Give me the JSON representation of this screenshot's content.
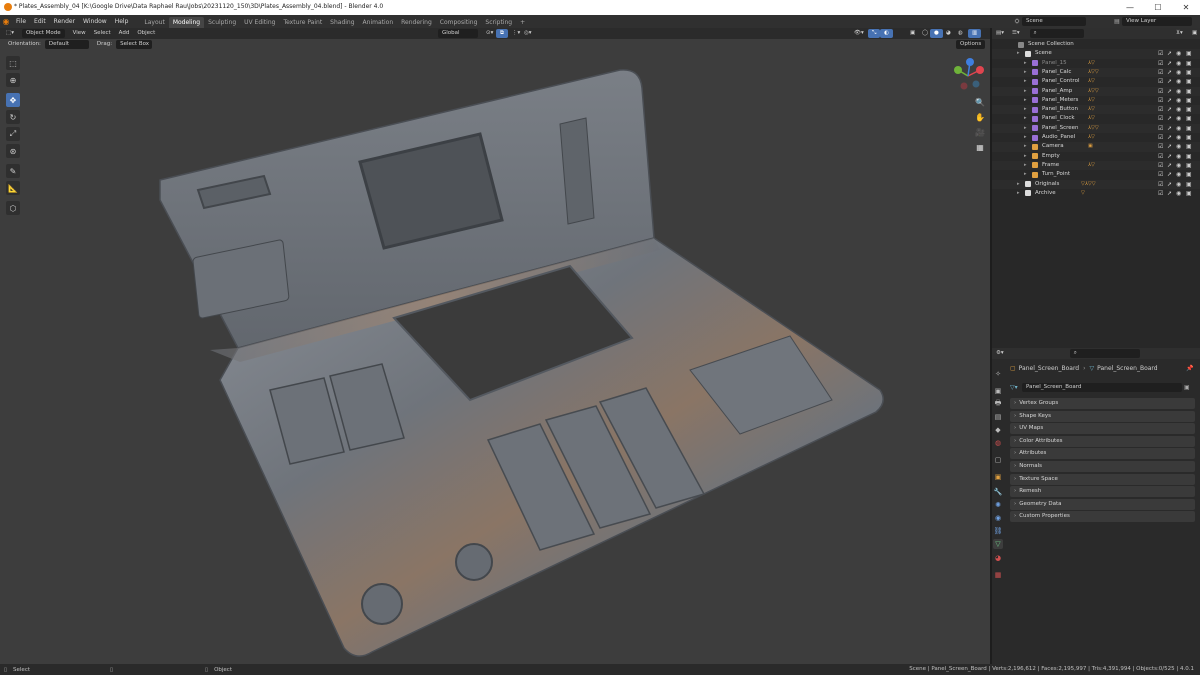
{
  "window": {
    "title": "* Plates_Assembly_04 [K:\\Google Drive\\Data Raphael Rau\\Jobs\\20231120_150\\3D\\Plates_Assembly_04.blend] - Blender 4.0",
    "minimize": "—",
    "maximize": "☐",
    "close": "✕"
  },
  "menus": [
    "File",
    "Edit",
    "Render",
    "Window",
    "Help"
  ],
  "workspaces": [
    "Layout",
    "Modeling",
    "Sculpting",
    "UV Editing",
    "Texture Paint",
    "Shading",
    "Animation",
    "Rendering",
    "Compositing",
    "Scripting"
  ],
  "active_workspace": "Modeling",
  "add_workspace": "+",
  "top_right": {
    "scene_label": "Scene",
    "view_layer_label": "View Layer"
  },
  "viewport_header": {
    "mode": "Object Mode",
    "menus": [
      "View",
      "Select",
      "Add",
      "Object"
    ],
    "transform_orientation": "Global",
    "orientation_label": "Orientation:",
    "orientation_value": "Default",
    "drag_label": "Drag:",
    "drag_value": "Select Box",
    "options": "Options"
  },
  "outliner": {
    "search_placeholder": "",
    "rows": [
      {
        "name": "Scene Collection",
        "depth": 0,
        "icon": "#888888",
        "mods": ""
      },
      {
        "name": "Scene",
        "depth": 1,
        "icon": "#dddddd",
        "mods": ""
      },
      {
        "name": "Panel_15",
        "depth": 2,
        "icon": "#9a6fd6",
        "mods": "⅄▽",
        "dim": true
      },
      {
        "name": "Panel_Calc",
        "depth": 2,
        "icon": "#9a6fd6",
        "mods": "⅄▽▽"
      },
      {
        "name": "Panel_Control",
        "depth": 2,
        "icon": "#9a6fd6",
        "mods": "⅄▽"
      },
      {
        "name": "Panel_Amp",
        "depth": 2,
        "icon": "#9a6fd6",
        "mods": "⅄▽▽"
      },
      {
        "name": "Panel_Meters",
        "depth": 2,
        "icon": "#9a6fd6",
        "mods": "⅄▽"
      },
      {
        "name": "Panel_Button",
        "depth": 2,
        "icon": "#9a6fd6",
        "mods": "⅄▽"
      },
      {
        "name": "Panel_Clock",
        "depth": 2,
        "icon": "#9a6fd6",
        "mods": "⅄▽"
      },
      {
        "name": "Panel_Screen",
        "depth": 2,
        "icon": "#9a6fd6",
        "mods": "⅄▽▽"
      },
      {
        "name": "Audio_Panel",
        "depth": 2,
        "icon": "#9a6fd6",
        "mods": "⅄▽"
      },
      {
        "name": "Camera",
        "depth": 2,
        "icon": "#e0a040",
        "mods": "▣"
      },
      {
        "name": "Empty",
        "depth": 2,
        "icon": "#e0a040",
        "mods": ""
      },
      {
        "name": "Frame",
        "depth": 2,
        "icon": "#e0a040",
        "mods": "⅄▽"
      },
      {
        "name": "Turn_Point",
        "depth": 2,
        "icon": "#e0a040",
        "mods": ""
      },
      {
        "name": "Originals",
        "depth": 1,
        "icon": "#dddddd",
        "mods": "▽⅄▽▽"
      },
      {
        "name": "Archive",
        "depth": 1,
        "icon": "#dddddd",
        "mods": "▽"
      }
    ]
  },
  "properties": {
    "breadcrumb_object": "Panel_Screen_Board",
    "breadcrumb_data": "Panel_Screen_Board",
    "mesh_name": "Panel_Screen_Board",
    "sections": [
      "Vertex Groups",
      "Shape Keys",
      "UV Maps",
      "Color Attributes",
      "Attributes",
      "Normals",
      "Texture Space",
      "Remesh",
      "Geometry Data",
      "Custom Properties"
    ]
  },
  "status": {
    "left_select": "Select",
    "middle_object": "Object",
    "stats": "Scene | Panel_Screen_Board | Verts:2,196,612 | Faces:2,195,997 | Tris:4,391,994 | Objects:0/525 | 4.0.1"
  },
  "colors": {
    "accent": "#4772b3",
    "axis_x": "#e0454f",
    "axis_y": "#6fb33a",
    "axis_z": "#3f7fe0"
  }
}
